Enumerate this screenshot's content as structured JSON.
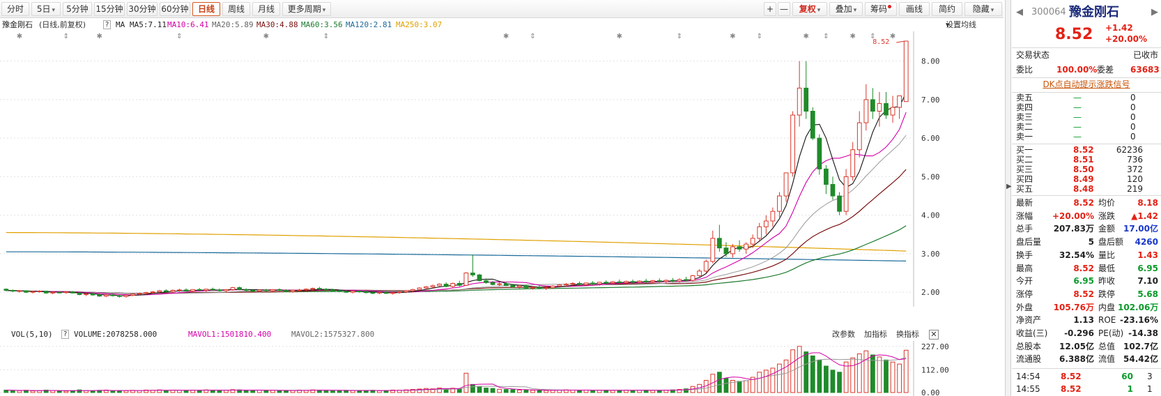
{
  "toolbar": {
    "periods": [
      "分时",
      "5日",
      "5分钟",
      "15分钟",
      "30分钟",
      "60分钟",
      "日线",
      "周线",
      "月线",
      "更多周期"
    ],
    "active_period": "日线",
    "right_tools": [
      "+",
      "—",
      "复权",
      "叠加",
      "筹码",
      "画线",
      "简约",
      "隐藏"
    ]
  },
  "legend": {
    "stock": "豫金刚石",
    "mode": "(日线,前复权)",
    "q": "?",
    "ma_label": "MA",
    "ma5": "MA5:7.11",
    "ma10": "MA10:6.41",
    "ma20": "MA20:5.89",
    "ma30": "MA30:4.88",
    "ma60": "MA60:3.56",
    "ma120": "MA120:2.81",
    "ma250": "MA250:3.07",
    "settings": "设置均线"
  },
  "price_axis": [
    "8.00",
    "7.00",
    "6.00",
    "5.00",
    "4.00",
    "3.00",
    "2.00"
  ],
  "last_price_label": "8.52",
  "volume": {
    "title": "VOL(5,10)",
    "q": "?",
    "volume": "VOLUME:2078258.000",
    "mavol1": "MAVOL1:1501810.400",
    "mavol2": "MAVOL2:1575327.800",
    "buttons": [
      "改参数",
      "加指标",
      "换指标"
    ],
    "axis": [
      "227.00",
      "112.00",
      "0.00"
    ]
  },
  "quote": {
    "code": "300064",
    "name": "豫金刚石",
    "price": "8.52",
    "change": "+1.42",
    "change_pct": "+20.00%",
    "status_label": "交易状态",
    "status": "已收市",
    "weibi_label": "委比",
    "weibi": "100.00%",
    "weicha_label": "委差",
    "weicha": "63683",
    "link": "DK点自动提示涨跌信号",
    "asks": [
      {
        "label": "卖五",
        "price": "—",
        "vol": "0"
      },
      {
        "label": "卖四",
        "price": "—",
        "vol": "0"
      },
      {
        "label": "卖三",
        "price": "—",
        "vol": "0"
      },
      {
        "label": "卖二",
        "price": "—",
        "vol": "0"
      },
      {
        "label": "卖一",
        "price": "—",
        "vol": "0"
      }
    ],
    "bids": [
      {
        "label": "买一",
        "price": "8.52",
        "vol": "62236"
      },
      {
        "label": "买二",
        "price": "8.51",
        "vol": "736"
      },
      {
        "label": "买三",
        "price": "8.50",
        "vol": "372"
      },
      {
        "label": "买四",
        "price": "8.49",
        "vol": "120"
      },
      {
        "label": "买五",
        "price": "8.48",
        "vol": "219"
      }
    ],
    "stats": [
      {
        "l1": "最新",
        "v1": "8.52",
        "c1": "r",
        "l2": "均价",
        "v2": "8.18",
        "c2": "r"
      },
      {
        "l1": "涨幅",
        "v1": "+20.00%",
        "c1": "r",
        "l2": "涨跌",
        "v2": "▲1.42",
        "c2": "r"
      },
      {
        "l1": "总手",
        "v1": "207.83万",
        "c1": "k",
        "l2": "金额",
        "v2": "17.00亿",
        "c2": "b"
      },
      {
        "l1": "盘后量",
        "v1": "5",
        "c1": "k",
        "l2": "盘后额",
        "v2": "4260",
        "c2": "b"
      },
      {
        "l1": "换手",
        "v1": "32.54%",
        "c1": "k",
        "l2": "量比",
        "v2": "1.43",
        "c2": "r"
      },
      {
        "l1": "最高",
        "v1": "8.52",
        "c1": "r",
        "l2": "最低",
        "v2": "6.95",
        "c2": "g"
      },
      {
        "l1": "今开",
        "v1": "6.95",
        "c1": "g",
        "l2": "昨收",
        "v2": "7.10",
        "c2": "k"
      },
      {
        "l1": "涨停",
        "v1": "8.52",
        "c1": "r",
        "l2": "跌停",
        "v2": "5.68",
        "c2": "g"
      },
      {
        "l1": "外盘",
        "v1": "105.76万",
        "c1": "r",
        "l2": "内盘",
        "v2": "102.06万",
        "c2": "g"
      },
      {
        "l1": "净资产",
        "v1": "1.13",
        "c1": "k",
        "l2": "ROE",
        "v2": "-23.16%",
        "c2": "k"
      },
      {
        "l1": "收益(三)",
        "v1": "-0.296",
        "c1": "k",
        "l2": "PE(动)",
        "v2": "-14.38",
        "c2": "k"
      },
      {
        "l1": "总股本",
        "v1": "12.05亿",
        "c1": "k",
        "l2": "总值",
        "v2": "102.7亿",
        "c2": "k"
      },
      {
        "l1": "流通股",
        "v1": "6.388亿",
        "c1": "k",
        "l2": "流值",
        "v2": "54.42亿",
        "c2": "k"
      }
    ],
    "ticks": [
      {
        "time": "14:54",
        "price": "8.52",
        "vol": "60",
        "n": "3"
      },
      {
        "time": "14:55",
        "price": "8.52",
        "vol": "1",
        "n": "1"
      }
    ]
  },
  "chart_data": {
    "type": "candlestick",
    "ylim": [
      1.75,
      8.7
    ],
    "vol_ylim": [
      0,
      240
    ],
    "bars": [
      {
        "o": 2.08,
        "h": 2.1,
        "l": 2.02,
        "c": 2.05,
        "v": 12
      },
      {
        "o": 2.05,
        "h": 2.07,
        "l": 2.0,
        "c": 2.03,
        "v": 10
      },
      {
        "o": 2.03,
        "h": 2.06,
        "l": 1.99,
        "c": 2.04,
        "v": 9
      },
      {
        "o": 2.04,
        "h": 2.05,
        "l": 1.98,
        "c": 2.0,
        "v": 11
      },
      {
        "o": 2.0,
        "h": 2.04,
        "l": 1.97,
        "c": 2.02,
        "v": 8
      },
      {
        "o": 2.02,
        "h": 2.05,
        "l": 1.99,
        "c": 2.03,
        "v": 9
      },
      {
        "o": 2.03,
        "h": 2.04,
        "l": 1.96,
        "c": 1.98,
        "v": 12
      },
      {
        "o": 1.98,
        "h": 2.02,
        "l": 1.95,
        "c": 2.0,
        "v": 10
      },
      {
        "o": 2.0,
        "h": 2.03,
        "l": 1.97,
        "c": 1.99,
        "v": 8
      },
      {
        "o": 1.99,
        "h": 2.02,
        "l": 1.96,
        "c": 2.01,
        "v": 7
      },
      {
        "o": 2.01,
        "h": 2.03,
        "l": 1.97,
        "c": 1.98,
        "v": 9
      },
      {
        "o": 1.98,
        "h": 2.0,
        "l": 1.92,
        "c": 1.94,
        "v": 13
      },
      {
        "o": 1.94,
        "h": 1.98,
        "l": 1.9,
        "c": 1.96,
        "v": 10
      },
      {
        "o": 1.96,
        "h": 1.99,
        "l": 1.91,
        "c": 1.93,
        "v": 9
      },
      {
        "o": 1.93,
        "h": 1.96,
        "l": 1.88,
        "c": 1.9,
        "v": 11
      },
      {
        "o": 1.9,
        "h": 1.95,
        "l": 1.87,
        "c": 1.93,
        "v": 12
      },
      {
        "o": 1.93,
        "h": 1.96,
        "l": 1.89,
        "c": 1.91,
        "v": 8
      },
      {
        "o": 1.91,
        "h": 1.94,
        "l": 1.86,
        "c": 1.89,
        "v": 10
      },
      {
        "o": 1.89,
        "h": 1.93,
        "l": 1.86,
        "c": 1.92,
        "v": 9
      },
      {
        "o": 1.92,
        "h": 1.96,
        "l": 1.9,
        "c": 1.95,
        "v": 11
      },
      {
        "o": 1.95,
        "h": 1.99,
        "l": 1.92,
        "c": 1.97,
        "v": 10
      },
      {
        "o": 1.97,
        "h": 2.01,
        "l": 1.94,
        "c": 1.99,
        "v": 12
      },
      {
        "o": 1.99,
        "h": 2.03,
        "l": 1.96,
        "c": 2.01,
        "v": 11
      },
      {
        "o": 2.01,
        "h": 2.06,
        "l": 1.98,
        "c": 2.04,
        "v": 13
      },
      {
        "o": 2.04,
        "h": 2.08,
        "l": 2.0,
        "c": 2.02,
        "v": 10
      },
      {
        "o": 2.02,
        "h": 2.07,
        "l": 1.99,
        "c": 2.05,
        "v": 12
      },
      {
        "o": 2.05,
        "h": 2.09,
        "l": 2.01,
        "c": 2.06,
        "v": 11
      },
      {
        "o": 2.06,
        "h": 2.1,
        "l": 2.02,
        "c": 2.03,
        "v": 10
      },
      {
        "o": 2.03,
        "h": 2.08,
        "l": 2.0,
        "c": 2.07,
        "v": 12
      },
      {
        "o": 2.07,
        "h": 2.11,
        "l": 2.03,
        "c": 2.05,
        "v": 11
      },
      {
        "o": 2.05,
        "h": 2.09,
        "l": 2.01,
        "c": 2.08,
        "v": 13
      },
      {
        "o": 2.08,
        "h": 2.12,
        "l": 2.04,
        "c": 2.06,
        "v": 12
      },
      {
        "o": 2.06,
        "h": 2.1,
        "l": 2.02,
        "c": 2.04,
        "v": 10
      },
      {
        "o": 2.04,
        "h": 2.08,
        "l": 2.0,
        "c": 2.07,
        "v": 11
      },
      {
        "o": 2.07,
        "h": 2.14,
        "l": 2.04,
        "c": 2.12,
        "v": 14
      },
      {
        "o": 2.12,
        "h": 2.15,
        "l": 2.05,
        "c": 2.07,
        "v": 13
      },
      {
        "o": 2.07,
        "h": 2.1,
        "l": 2.02,
        "c": 2.05,
        "v": 11
      },
      {
        "o": 2.05,
        "h": 2.08,
        "l": 2.01,
        "c": 2.03,
        "v": 10
      },
      {
        "o": 2.03,
        "h": 2.07,
        "l": 2.0,
        "c": 2.06,
        "v": 12
      },
      {
        "o": 2.06,
        "h": 2.09,
        "l": 2.02,
        "c": 2.04,
        "v": 10
      },
      {
        "o": 2.04,
        "h": 2.08,
        "l": 2.01,
        "c": 2.07,
        "v": 11
      },
      {
        "o": 2.07,
        "h": 2.1,
        "l": 2.03,
        "c": 2.05,
        "v": 10
      },
      {
        "o": 2.05,
        "h": 2.08,
        "l": 2.0,
        "c": 2.02,
        "v": 9
      },
      {
        "o": 2.02,
        "h": 2.06,
        "l": 1.99,
        "c": 2.05,
        "v": 10
      },
      {
        "o": 2.05,
        "h": 2.09,
        "l": 2.01,
        "c": 2.06,
        "v": 12
      },
      {
        "o": 2.06,
        "h": 2.1,
        "l": 2.03,
        "c": 2.08,
        "v": 11
      },
      {
        "o": 2.08,
        "h": 2.12,
        "l": 2.04,
        "c": 2.1,
        "v": 13
      },
      {
        "o": 2.1,
        "h": 2.14,
        "l": 2.06,
        "c": 2.08,
        "v": 12
      },
      {
        "o": 2.08,
        "h": 2.11,
        "l": 2.04,
        "c": 2.06,
        "v": 10
      },
      {
        "o": 2.06,
        "h": 2.09,
        "l": 2.02,
        "c": 2.04,
        "v": 9
      },
      {
        "o": 2.04,
        "h": 2.07,
        "l": 2.0,
        "c": 2.02,
        "v": 10
      },
      {
        "o": 2.02,
        "h": 2.05,
        "l": 1.98,
        "c": 2.0,
        "v": 11
      },
      {
        "o": 2.0,
        "h": 2.04,
        "l": 1.97,
        "c": 2.03,
        "v": 10
      },
      {
        "o": 2.03,
        "h": 2.06,
        "l": 1.99,
        "c": 2.01,
        "v": 9
      },
      {
        "o": 2.01,
        "h": 2.04,
        "l": 1.97,
        "c": 1.99,
        "v": 10
      },
      {
        "o": 1.99,
        "h": 2.02,
        "l": 1.95,
        "c": 1.98,
        "v": 11
      },
      {
        "o": 1.98,
        "h": 2.01,
        "l": 1.95,
        "c": 2.0,
        "v": 9
      },
      {
        "o": 2.0,
        "h": 2.03,
        "l": 1.96,
        "c": 1.97,
        "v": 10
      },
      {
        "o": 1.97,
        "h": 2.01,
        "l": 1.94,
        "c": 1.99,
        "v": 12
      },
      {
        "o": 1.99,
        "h": 2.03,
        "l": 1.96,
        "c": 2.01,
        "v": 11
      },
      {
        "o": 2.01,
        "h": 2.06,
        "l": 1.98,
        "c": 2.04,
        "v": 13
      },
      {
        "o": 2.04,
        "h": 2.09,
        "l": 2.0,
        "c": 2.07,
        "v": 15
      },
      {
        "o": 2.07,
        "h": 2.13,
        "l": 2.04,
        "c": 2.11,
        "v": 17
      },
      {
        "o": 2.11,
        "h": 2.16,
        "l": 2.07,
        "c": 2.14,
        "v": 20
      },
      {
        "o": 2.14,
        "h": 2.2,
        "l": 2.1,
        "c": 2.17,
        "v": 18
      },
      {
        "o": 2.17,
        "h": 2.23,
        "l": 2.12,
        "c": 2.21,
        "v": 22
      },
      {
        "o": 2.21,
        "h": 2.26,
        "l": 2.13,
        "c": 2.15,
        "v": 19
      },
      {
        "o": 2.15,
        "h": 2.25,
        "l": 2.12,
        "c": 2.23,
        "v": 21
      },
      {
        "o": 2.23,
        "h": 2.3,
        "l": 2.15,
        "c": 2.18,
        "v": 18
      },
      {
        "o": 2.18,
        "h": 2.52,
        "l": 2.17,
        "c": 2.5,
        "v": 95
      },
      {
        "o": 2.5,
        "h": 2.98,
        "l": 2.4,
        "c": 2.45,
        "v": 40
      },
      {
        "o": 2.45,
        "h": 2.48,
        "l": 2.28,
        "c": 2.3,
        "v": 30
      },
      {
        "o": 2.3,
        "h": 2.36,
        "l": 2.22,
        "c": 2.25,
        "v": 22
      },
      {
        "o": 2.25,
        "h": 2.29,
        "l": 2.18,
        "c": 2.2,
        "v": 20
      },
      {
        "o": 2.2,
        "h": 2.26,
        "l": 2.15,
        "c": 2.22,
        "v": 16
      },
      {
        "o": 2.22,
        "h": 2.27,
        "l": 2.16,
        "c": 2.18,
        "v": 15
      },
      {
        "o": 2.18,
        "h": 2.22,
        "l": 2.12,
        "c": 2.14,
        "v": 14
      },
      {
        "o": 2.14,
        "h": 2.19,
        "l": 2.1,
        "c": 2.17,
        "v": 12
      },
      {
        "o": 2.17,
        "h": 2.2,
        "l": 2.09,
        "c": 2.11,
        "v": 13
      },
      {
        "o": 2.11,
        "h": 2.15,
        "l": 2.07,
        "c": 2.13,
        "v": 11
      },
      {
        "o": 2.13,
        "h": 2.17,
        "l": 2.08,
        "c": 2.1,
        "v": 12
      },
      {
        "o": 2.1,
        "h": 2.15,
        "l": 2.06,
        "c": 2.12,
        "v": 10
      },
      {
        "o": 2.12,
        "h": 2.18,
        "l": 2.09,
        "c": 2.16,
        "v": 11
      },
      {
        "o": 2.16,
        "h": 2.21,
        "l": 2.12,
        "c": 2.19,
        "v": 12
      },
      {
        "o": 2.19,
        "h": 2.24,
        "l": 2.15,
        "c": 2.21,
        "v": 13
      },
      {
        "o": 2.21,
        "h": 2.26,
        "l": 2.17,
        "c": 2.23,
        "v": 12
      },
      {
        "o": 2.23,
        "h": 2.28,
        "l": 2.18,
        "c": 2.2,
        "v": 11
      },
      {
        "o": 2.2,
        "h": 2.25,
        "l": 2.16,
        "c": 2.24,
        "v": 12
      },
      {
        "o": 2.24,
        "h": 2.29,
        "l": 2.19,
        "c": 2.22,
        "v": 10
      },
      {
        "o": 2.22,
        "h": 2.27,
        "l": 2.17,
        "c": 2.26,
        "v": 11
      },
      {
        "o": 2.26,
        "h": 2.31,
        "l": 2.21,
        "c": 2.24,
        "v": 12
      },
      {
        "o": 2.24,
        "h": 2.29,
        "l": 2.2,
        "c": 2.27,
        "v": 10
      },
      {
        "o": 2.27,
        "h": 2.33,
        "l": 2.22,
        "c": 2.25,
        "v": 11
      },
      {
        "o": 2.25,
        "h": 2.3,
        "l": 2.2,
        "c": 2.28,
        "v": 12
      },
      {
        "o": 2.28,
        "h": 2.33,
        "l": 2.23,
        "c": 2.26,
        "v": 10
      },
      {
        "o": 2.26,
        "h": 2.31,
        "l": 2.21,
        "c": 2.29,
        "v": 11
      },
      {
        "o": 2.29,
        "h": 2.35,
        "l": 2.24,
        "c": 2.27,
        "v": 12
      },
      {
        "o": 2.27,
        "h": 2.32,
        "l": 2.22,
        "c": 2.3,
        "v": 10
      },
      {
        "o": 2.3,
        "h": 2.36,
        "l": 2.25,
        "c": 2.28,
        "v": 11
      },
      {
        "o": 2.28,
        "h": 2.33,
        "l": 2.23,
        "c": 2.31,
        "v": 12
      },
      {
        "o": 2.31,
        "h": 2.37,
        "l": 2.26,
        "c": 2.29,
        "v": 13
      },
      {
        "o": 2.29,
        "h": 2.36,
        "l": 2.25,
        "c": 2.33,
        "v": 15
      },
      {
        "o": 2.33,
        "h": 2.4,
        "l": 2.28,
        "c": 2.31,
        "v": 18
      },
      {
        "o": 2.31,
        "h": 2.45,
        "l": 2.28,
        "c": 2.43,
        "v": 30
      },
      {
        "o": 2.43,
        "h": 2.6,
        "l": 2.38,
        "c": 2.55,
        "v": 40
      },
      {
        "o": 2.55,
        "h": 2.85,
        "l": 2.5,
        "c": 2.8,
        "v": 60
      },
      {
        "o": 2.8,
        "h": 3.6,
        "l": 2.75,
        "c": 3.4,
        "v": 90
      },
      {
        "o": 3.4,
        "h": 3.75,
        "l": 3.05,
        "c": 3.15,
        "v": 100
      },
      {
        "o": 3.15,
        "h": 3.3,
        "l": 2.92,
        "c": 3.0,
        "v": 70
      },
      {
        "o": 3.0,
        "h": 3.25,
        "l": 2.9,
        "c": 3.18,
        "v": 60
      },
      {
        "o": 3.18,
        "h": 3.35,
        "l": 3.05,
        "c": 3.12,
        "v": 55
      },
      {
        "o": 3.12,
        "h": 3.3,
        "l": 3.0,
        "c": 3.25,
        "v": 58
      },
      {
        "o": 3.25,
        "h": 3.5,
        "l": 3.15,
        "c": 3.4,
        "v": 75
      },
      {
        "o": 3.4,
        "h": 3.8,
        "l": 3.3,
        "c": 3.7,
        "v": 100
      },
      {
        "o": 3.7,
        "h": 4.0,
        "l": 3.5,
        "c": 3.85,
        "v": 110
      },
      {
        "o": 3.85,
        "h": 4.2,
        "l": 3.7,
        "c": 4.1,
        "v": 120
      },
      {
        "o": 4.1,
        "h": 4.6,
        "l": 3.95,
        "c": 4.5,
        "v": 140
      },
      {
        "o": 4.5,
        "h": 5.0,
        "l": 4.35,
        "c": 5.1,
        "v": 160
      },
      {
        "o": 5.1,
        "h": 6.7,
        "l": 5.0,
        "c": 6.6,
        "v": 210
      },
      {
        "o": 6.6,
        "h": 8.0,
        "l": 6.3,
        "c": 7.3,
        "v": 227
      },
      {
        "o": 7.3,
        "h": 8.0,
        "l": 6.5,
        "c": 6.7,
        "v": 200
      },
      {
        "o": 6.7,
        "h": 6.8,
        "l": 5.95,
        "c": 6.0,
        "v": 180
      },
      {
        "o": 6.0,
        "h": 6.1,
        "l": 5.05,
        "c": 5.2,
        "v": 160
      },
      {
        "o": 5.2,
        "h": 5.3,
        "l": 4.55,
        "c": 4.8,
        "v": 130
      },
      {
        "o": 4.8,
        "h": 5.0,
        "l": 4.4,
        "c": 4.5,
        "v": 110
      },
      {
        "o": 4.5,
        "h": 4.6,
        "l": 4.0,
        "c": 4.1,
        "v": 100
      },
      {
        "o": 4.1,
        "h": 5.2,
        "l": 4.0,
        "c": 5.0,
        "v": 150
      },
      {
        "o": 5.0,
        "h": 5.9,
        "l": 4.9,
        "c": 5.7,
        "v": 170
      },
      {
        "o": 5.7,
        "h": 6.7,
        "l": 5.5,
        "c": 6.4,
        "v": 190
      },
      {
        "o": 6.4,
        "h": 7.4,
        "l": 6.2,
        "c": 7.0,
        "v": 205
      },
      {
        "o": 7.0,
        "h": 7.3,
        "l": 6.5,
        "c": 6.7,
        "v": 185
      },
      {
        "o": 6.7,
        "h": 7.2,
        "l": 6.3,
        "c": 6.9,
        "v": 175
      },
      {
        "o": 6.9,
        "h": 7.2,
        "l": 6.5,
        "c": 6.6,
        "v": 160
      },
      {
        "o": 6.6,
        "h": 7.1,
        "l": 6.4,
        "c": 6.8,
        "v": 150
      },
      {
        "o": 6.8,
        "h": 7.1,
        "l": 6.5,
        "c": 7.1,
        "v": 140
      },
      {
        "o": 6.95,
        "h": 8.52,
        "l": 6.95,
        "c": 8.52,
        "v": 208
      }
    ]
  }
}
